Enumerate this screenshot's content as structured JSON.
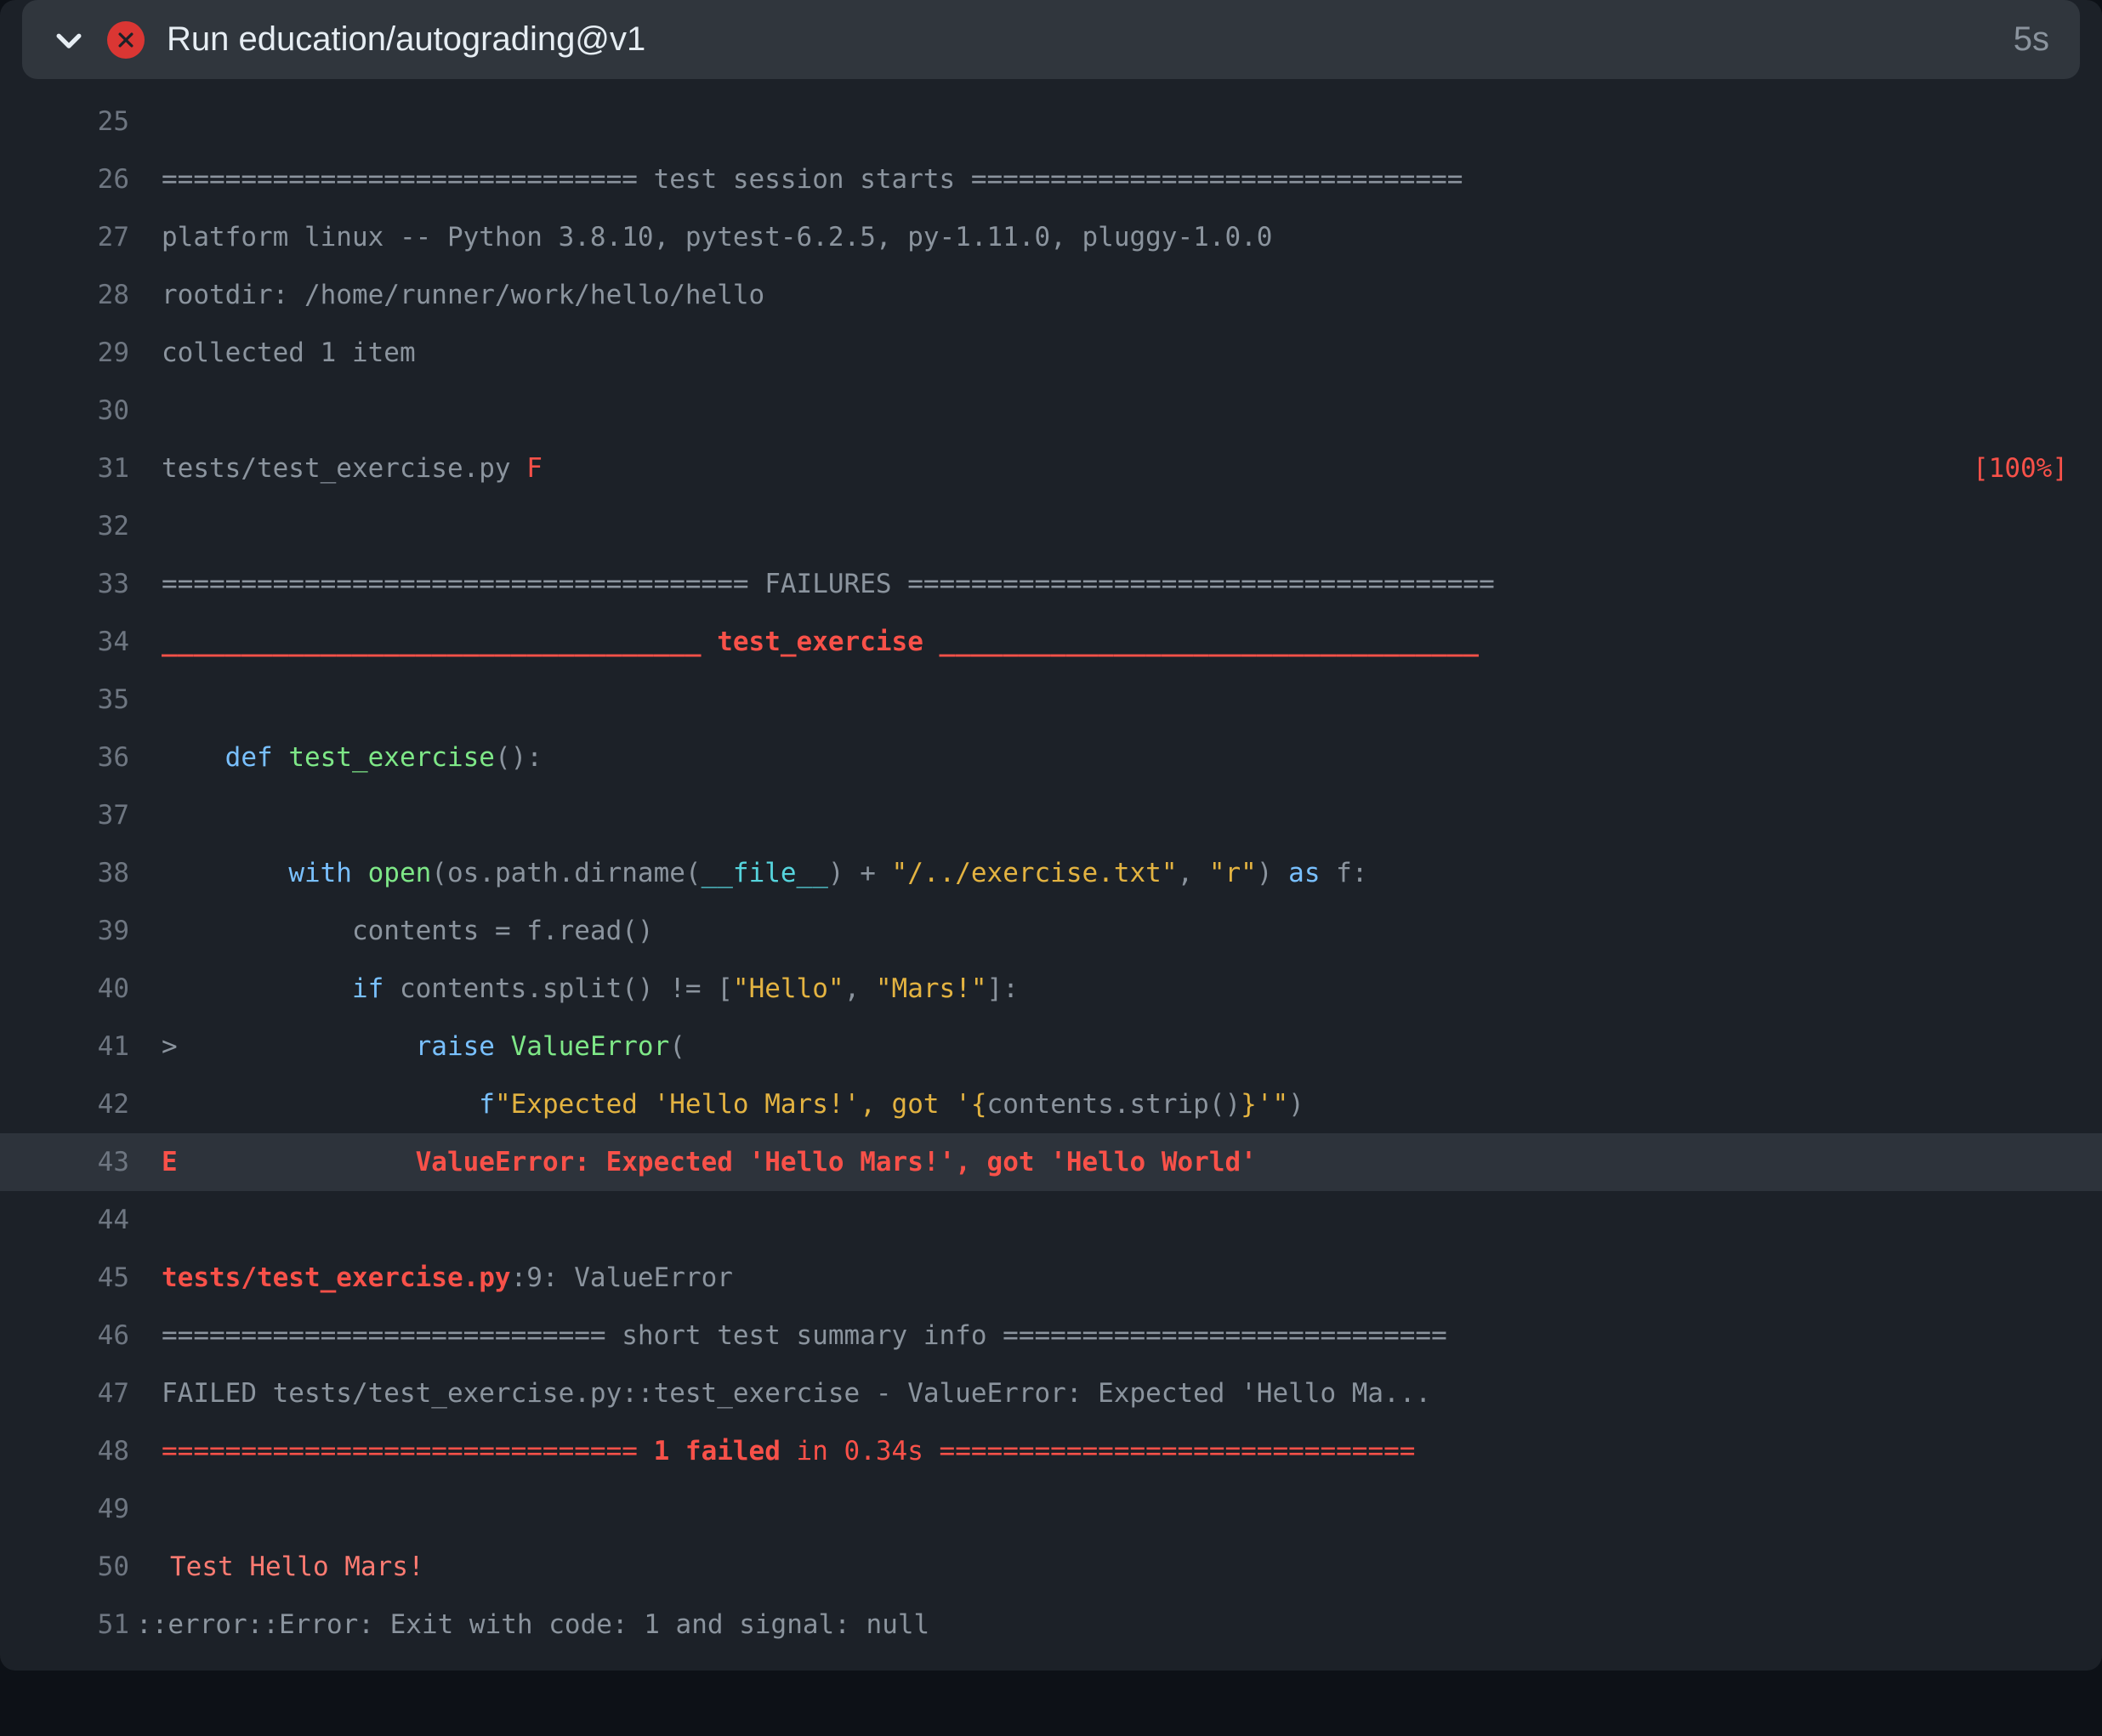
{
  "header": {
    "title": "Run education/autograding@v1",
    "duration": "5s"
  },
  "lines": {
    "l25": "25",
    "l26": "26",
    "l27": "27",
    "l28": "28",
    "l29": "29",
    "l30": "30",
    "l31": "31",
    "l32": "32",
    "l33": "33",
    "l34": "34",
    "l35": "35",
    "l36": "36",
    "l37": "37",
    "l38": "38",
    "l39": "39",
    "l40": "40",
    "l41": "41",
    "l42": "42",
    "l43": "43",
    "l44": "44",
    "l45": "45",
    "l46": "46",
    "l47": "47",
    "l48": "48",
    "l49": "49",
    "l50": "50",
    "l51": "51"
  },
  "log": {
    "sess_left": "============================== ",
    "sess_mid": "test session starts",
    "sess_right": " ===============================",
    "platform": "platform linux -- Python 3.8.10, pytest-6.2.5, py-1.11.0, pluggy-1.0.0",
    "rootdir": "rootdir: /home/runner/work/hello/hello",
    "collected": "collected 1 item",
    "tfile": "tests/test_exercise.py ",
    "tfile_status": "F",
    "tfile_pct": "[100%]",
    "fail_left": "===================================== ",
    "fail_mid": "FAILURES",
    "fail_right": " =====================================",
    "tc_left": "__________________________________ ",
    "tc_mid": "test_exercise",
    "tc_right": " __________________________________",
    "def_indent": "    ",
    "kw_def": "def ",
    "fn_name": "test_exercise",
    "fn_paren": "():",
    "with_indent": "        ",
    "kw_with": "with ",
    "open_call": "open",
    "open_args_a": "(os.path.dirname(",
    "dunder": "__file__",
    "open_args_b": ") + ",
    "str_path": "\"/../exercise.txt\"",
    "comma": ", ",
    "str_r": "\"r\"",
    "close_paren": ") ",
    "kw_as": "as",
    "as_f": " f:",
    "body_indent": "            ",
    "contents_line": "contents = f.read()",
    "if_kw": "if",
    "if_cond": " contents.split() != [",
    "str_hello": "\"Hello\"",
    "str_mars": "\"Mars!\"",
    "if_close": "]:",
    "caret": ">",
    "caret_pad": "               ",
    "raise_kw": "raise ",
    "exc_name": "ValueError",
    "exc_open": "(",
    "deep_indent": "                    ",
    "fstr_pre": "f",
    "fstr_a": "\"Expected 'Hello Mars!', got '",
    "fstr_brace_open": "{",
    "fstr_expr": "contents.strip()",
    "fstr_brace_close": "}",
    "fstr_b": "'\"",
    "fstr_close": ")",
    "e_mark": "E",
    "e_pad": "               ",
    "e_msg": "ValueError: Expected 'Hello Mars!', got 'Hello World'",
    "loc_file": "tests/test_exercise.py",
    "loc_rest": ":9: ValueError",
    "sum_left": "============================ ",
    "sum_mid": "short test summary info",
    "sum_right": " ============================",
    "failed_line": "FAILED tests/test_exercise.py::test_exercise - ValueError: Expected 'Hello Ma...",
    "time_left": "============================== ",
    "time_mid": "1 failed",
    "time_in": " in 0.34s",
    "time_right": " ==============================",
    "x_text": "Test Hello Mars!",
    "err_line": "::error::Error: Exit with code: 1 and signal: null"
  }
}
